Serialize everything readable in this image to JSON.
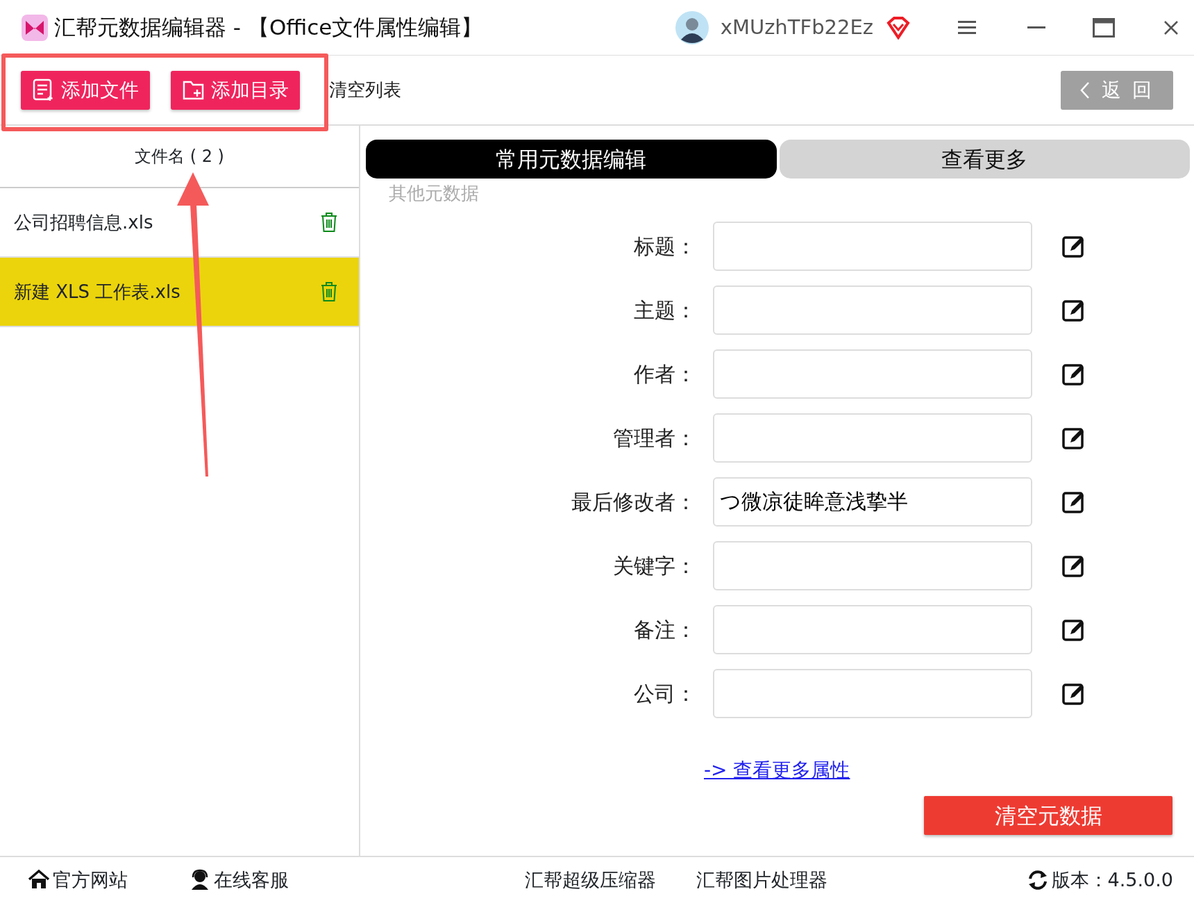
{
  "window": {
    "title": "汇帮元数据编辑器 - 【Office文件属性编辑】",
    "username": "xMUzhTFb22Ez"
  },
  "toolbar": {
    "buttons": [
      {
        "kind": "file",
        "label": "添加文件"
      },
      {
        "kind": "folder",
        "label": "添加目录"
      }
    ],
    "clear_list": "清空列表",
    "back": "返 回"
  },
  "file_list": {
    "header": "文件名 ( 2 )",
    "files": [
      {
        "name": "公司招聘信息.xls",
        "selected": false
      },
      {
        "name": "新建 XLS 工作表.xls",
        "selected": true
      }
    ]
  },
  "tabs": [
    {
      "label": "常用元数据编辑",
      "selected": true
    },
    {
      "label": "查看更多",
      "selected": false
    }
  ],
  "section_label": "其他元数据",
  "fields": [
    {
      "label": "标题："
    },
    {
      "label": "主题："
    },
    {
      "label": "作者："
    },
    {
      "label": "管理者："
    },
    {
      "label": "最后修改者：",
      "value": "つ微凉徒眸意浅挚半"
    },
    {
      "label": "关键字："
    },
    {
      "label": "备注："
    },
    {
      "label": "公司："
    }
  ],
  "more_link": "-> 查看更多属性",
  "clear_button": "清空元数据",
  "footer": {
    "links": [
      {
        "kind": "home",
        "label": "官方网站"
      },
      {
        "kind": "support",
        "label": "在线客服"
      }
    ],
    "products": [
      "汇帮超级压缩器",
      "汇帮图片处理器"
    ],
    "version": "版本：4.5.0.0"
  }
}
